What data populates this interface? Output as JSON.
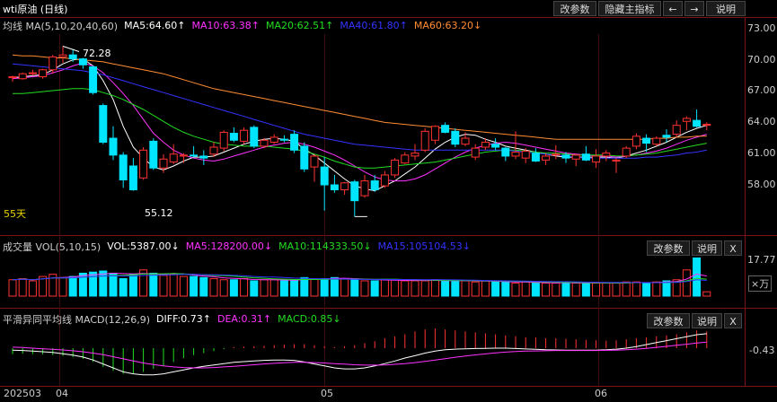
{
  "title": {
    "symbol": "wti原油 (日线)",
    "buttons": [
      "改参数",
      "隐藏主指标",
      "←",
      "→",
      "说明"
    ]
  },
  "main": {
    "ma_label": "均线 MA(5,10,20,40,60)",
    "ma_values": [
      {
        "text": "MA5:64.60↑",
        "color": "#ffffff"
      },
      {
        "text": "MA10:63.38↑",
        "color": "#ff33ff"
      },
      {
        "text": "MA20:62.51↑",
        "color": "#22dd22"
      },
      {
        "text": "MA40:61.80↑",
        "color": "#3333ff"
      },
      {
        "text": "MA60:63.20↓",
        "color": "#ff8c33"
      }
    ],
    "y_ticks": [
      "73.00",
      "70.00",
      "67.00",
      "64.00",
      "61.00",
      "58.00"
    ],
    "high_label": "72.28",
    "low_label": "55.12",
    "period_label": "55天"
  },
  "volume": {
    "label": "成交量 VOL(5,10,15)",
    "values": [
      {
        "text": "VOL:5387.00↓",
        "color": "#ffffff"
      },
      {
        "text": "MA5:128200.00↓",
        "color": "#ff33ff"
      },
      {
        "text": "MA10:114333.50↓",
        "color": "#22dd22"
      },
      {
        "text": "MA15:105104.53↓",
        "color": "#3333ff"
      }
    ],
    "buttons": [
      "改参数",
      "说明",
      "X"
    ],
    "y_tick": "17.77",
    "unit": "×万"
  },
  "macd": {
    "label": "平滑异同平均线 MACD(12,26,9)",
    "values": [
      {
        "text": "DIFF:0.73↑",
        "color": "#ffffff"
      },
      {
        "text": "DEA:0.31↑",
        "color": "#ff33ff"
      },
      {
        "text": "MACD:0.85↓",
        "color": "#22dd22"
      }
    ],
    "buttons": [
      "改参数",
      "说明",
      "X"
    ],
    "y_tick": "-0.43"
  },
  "x_axis": [
    "202503",
    "04",
    "05",
    "06"
  ],
  "colors": {
    "up": "#ff3232",
    "down": "#00e5ff",
    "grid": "#7a1414"
  },
  "chart_data": {
    "type": "candlestick",
    "ylim": [
      54.5,
      73.5
    ],
    "candles": [
      [
        69.1,
        69.3,
        68.7,
        69.2
      ],
      [
        69.0,
        69.6,
        68.9,
        69.5
      ],
      [
        69.5,
        69.9,
        69.3,
        69.6
      ],
      [
        69.2,
        70.0,
        69.0,
        69.9
      ],
      [
        69.9,
        71.4,
        69.5,
        71.2
      ],
      [
        71.2,
        72.28,
        70.6,
        71.4
      ],
      [
        71.4,
        72.0,
        70.7,
        71.0
      ],
      [
        71.0,
        71.1,
        70.0,
        70.4
      ],
      [
        70.2,
        70.3,
        67.4,
        67.6
      ],
      [
        66.3,
        66.5,
        62.4,
        62.6
      ],
      [
        63.0,
        64.2,
        60.8,
        61.3
      ],
      [
        61.3,
        61.6,
        58.0,
        58.8
      ],
      [
        60.2,
        61.0,
        57.7,
        57.8
      ],
      [
        59.0,
        62.1,
        58.8,
        61.8
      ],
      [
        62.7,
        63.0,
        59.8,
        60.0
      ],
      [
        60.0,
        61.4,
        59.5,
        60.9
      ],
      [
        60.6,
        62.4,
        60.4,
        61.4
      ],
      [
        61.2,
        61.5,
        60.5,
        61.3
      ],
      [
        61.3,
        62.2,
        61.1,
        61.2
      ],
      [
        61.2,
        61.8,
        60.3,
        61.0
      ],
      [
        61.4,
        62.6,
        61.1,
        62.1
      ],
      [
        62.0,
        63.8,
        61.7,
        63.6
      ],
      [
        63.5,
        64.1,
        62.6,
        62.8
      ],
      [
        62.7,
        64.1,
        62.4,
        63.8
      ],
      [
        64.1,
        64.3,
        62.0,
        62.2
      ],
      [
        62.2,
        63.0,
        62.0,
        62.8
      ],
      [
        62.6,
        63.4,
        62.4,
        63.1
      ],
      [
        62.9,
        63.3,
        62.6,
        62.8
      ],
      [
        63.4,
        63.8,
        61.5,
        61.8
      ],
      [
        62.2,
        62.6,
        59.6,
        59.9
      ],
      [
        60.1,
        61.4,
        58.6,
        61.2
      ],
      [
        60.1,
        61.1,
        55.7,
        58.3
      ],
      [
        58.3,
        59.3,
        57.5,
        57.8
      ],
      [
        57.8,
        58.6,
        57.3,
        58.5
      ],
      [
        58.6,
        58.8,
        55.1,
        56.7
      ],
      [
        57.2,
        59.3,
        57.0,
        58.7
      ],
      [
        58.7,
        59.3,
        57.6,
        57.8
      ],
      [
        58.2,
        59.7,
        58.0,
        59.3
      ],
      [
        59.3,
        61.0,
        59.0,
        60.8
      ],
      [
        60.5,
        61.6,
        60.4,
        61.3
      ],
      [
        61.2,
        62.4,
        60.8,
        61.5
      ],
      [
        61.8,
        64.0,
        61.6,
        63.7
      ],
      [
        62.8,
        64.3,
        62.4,
        64.2
      ],
      [
        64.3,
        64.6,
        63.5,
        63.6
      ],
      [
        63.7,
        64.0,
        62.1,
        62.4
      ],
      [
        62.4,
        63.6,
        62.2,
        63.0
      ],
      [
        61.1,
        62.4,
        60.8,
        62.0
      ],
      [
        62.1,
        63.0,
        61.8,
        62.6
      ],
      [
        62.4,
        63.0,
        61.8,
        62.1
      ],
      [
        62.0,
        62.1,
        60.7,
        61.2
      ],
      [
        61.2,
        63.7,
        60.9,
        61.6
      ],
      [
        61.0,
        62.0,
        60.5,
        61.7
      ],
      [
        61.5,
        62.0,
        60.6,
        60.7
      ],
      [
        60.8,
        61.5,
        60.3,
        61.2
      ],
      [
        61.3,
        62.3,
        60.9,
        61.4
      ],
      [
        61.3,
        61.6,
        60.5,
        61.0
      ],
      [
        60.9,
        61.4,
        60.2,
        61.3
      ],
      [
        61.4,
        62.2,
        60.7,
        60.8
      ],
      [
        60.6,
        61.9,
        60.0,
        61.2
      ],
      [
        61.2,
        61.8,
        60.7,
        61.5
      ],
      [
        60.7,
        61.0,
        59.5,
        60.8
      ],
      [
        61.2,
        62.2,
        61.0,
        62.0
      ],
      [
        62.2,
        63.5,
        61.9,
        63.2
      ],
      [
        63.0,
        63.4,
        61.6,
        62.5
      ],
      [
        62.4,
        63.2,
        62.2,
        63.0
      ],
      [
        63.3,
        63.9,
        62.6,
        63.1
      ],
      [
        63.4,
        64.8,
        63.1,
        64.3
      ],
      [
        64.7,
        65.2,
        63.8,
        65.0
      ],
      [
        64.8,
        65.9,
        64.1,
        64.2
      ],
      [
        64.3,
        64.6,
        63.8,
        64.4
      ]
    ],
    "ma_lines": {
      "MA5": [
        69.1,
        69.2,
        69.3,
        69.4,
        69.9,
        70.5,
        70.9,
        71.0,
        70.3,
        68.8,
        66.9,
        64.2,
        62.1,
        61.0,
        60.1,
        59.8,
        60.2,
        60.7,
        61.1,
        61.1,
        61.2,
        61.6,
        62.0,
        62.4,
        62.7,
        62.9,
        63.0,
        62.9,
        62.7,
        61.9,
        61.3,
        60.5,
        59.7,
        58.9,
        58.2,
        57.9,
        57.7,
        58.2,
        58.7,
        59.4,
        60.1,
        61.0,
        61.9,
        62.6,
        63.1,
        63.4,
        63.3,
        62.9,
        62.6,
        62.2,
        62.0,
        61.8,
        61.6,
        61.4,
        61.2,
        61.1,
        61.1,
        61.1,
        61.1,
        61.1,
        61.0,
        61.2,
        61.5,
        61.8,
        62.2,
        62.6,
        63.1,
        63.6,
        64.0,
        64.3
      ],
      "MA10": [
        69.0,
        69.1,
        69.2,
        69.3,
        69.6,
        69.9,
        70.3,
        70.6,
        70.3,
        69.6,
        68.6,
        67.5,
        66.3,
        64.9,
        63.5,
        62.6,
        61.8,
        61.3,
        61.0,
        60.8,
        60.7,
        60.9,
        61.2,
        61.5,
        61.8,
        62.1,
        62.3,
        62.5,
        62.6,
        62.4,
        62.1,
        61.7,
        61.3,
        60.8,
        60.2,
        59.6,
        59.1,
        58.8,
        58.7,
        58.7,
        58.9,
        59.3,
        59.9,
        60.5,
        61.1,
        61.6,
        62.0,
        62.3,
        62.5,
        62.6,
        62.5,
        62.3,
        62.1,
        61.9,
        61.7,
        61.5,
        61.4,
        61.3,
        61.2,
        61.2,
        61.1,
        61.2,
        61.3,
        61.5,
        61.7,
        62.0,
        62.4,
        62.8,
        63.1,
        63.4
      ],
      "MA20": [
        67.5,
        67.5,
        67.6,
        67.7,
        67.8,
        67.9,
        68.0,
        68.0,
        67.9,
        67.6,
        67.3,
        66.9,
        66.4,
        65.9,
        65.3,
        64.7,
        64.1,
        63.6,
        63.2,
        62.9,
        62.6,
        62.4,
        62.3,
        62.2,
        62.2,
        62.2,
        62.1,
        62.0,
        61.9,
        61.7,
        61.4,
        61.1,
        60.7,
        60.4,
        60.1,
        60.0,
        60.0,
        60.1,
        60.2,
        60.3,
        60.4,
        60.5,
        60.6,
        60.8,
        61.0,
        61.2,
        61.4,
        61.6,
        61.7,
        61.8,
        61.8,
        61.7,
        61.6,
        61.5,
        61.5,
        61.4,
        61.3,
        61.3,
        61.3,
        61.3,
        61.2,
        61.2,
        61.3,
        61.4,
        61.5,
        61.7,
        61.9,
        62.1,
        62.3,
        62.5
      ],
      "MA40": [
        70.5,
        70.4,
        70.3,
        70.2,
        70.1,
        70.0,
        69.9,
        69.8,
        69.6,
        69.4,
        69.1,
        68.8,
        68.5,
        68.2,
        67.9,
        67.6,
        67.3,
        67.0,
        66.7,
        66.4,
        66.1,
        65.8,
        65.5,
        65.2,
        64.9,
        64.6,
        64.3,
        64.0,
        63.7,
        63.4,
        63.2,
        63.0,
        62.8,
        62.6,
        62.4,
        62.3,
        62.2,
        62.1,
        62.0,
        61.9,
        61.8,
        61.8,
        61.8,
        61.8,
        61.8,
        61.8,
        61.8,
        61.8,
        61.8,
        61.8,
        61.7,
        61.6,
        61.5,
        61.4,
        61.3,
        61.2,
        61.1,
        61.0,
        61.0,
        61.0,
        61.0,
        61.0,
        61.0,
        61.1,
        61.1,
        61.2,
        61.3,
        61.5,
        61.6,
        61.8
      ],
      "MA60": [
        71.4,
        71.3,
        71.3,
        71.2,
        71.1,
        71.1,
        71.0,
        70.9,
        70.8,
        70.7,
        70.5,
        70.3,
        70.1,
        69.9,
        69.7,
        69.5,
        69.2,
        68.9,
        68.6,
        68.3,
        68.0,
        67.8,
        67.6,
        67.4,
        67.2,
        67.0,
        66.8,
        66.6,
        66.4,
        66.2,
        66.0,
        65.8,
        65.6,
        65.4,
        65.2,
        65.0,
        64.8,
        64.6,
        64.5,
        64.4,
        64.3,
        64.2,
        64.1,
        64.0,
        63.9,
        63.8,
        63.7,
        63.6,
        63.5,
        63.4,
        63.3,
        63.2,
        63.1,
        63.0,
        62.9,
        62.9,
        62.9,
        62.9,
        62.9,
        62.9,
        62.9,
        62.9,
        62.9,
        62.9,
        63.0,
        63.0,
        63.1,
        63.1,
        63.2,
        63.2
      ]
    },
    "volume": [
      7.5,
      8.0,
      7.0,
      9.0,
      10.0,
      8.5,
      9.0,
      10.5,
      11.0,
      11.5,
      10.5,
      8.0,
      10.0,
      12.0,
      10.5,
      9.5,
      10.0,
      9.0,
      9.0,
      8.5,
      8.0,
      7.5,
      7.5,
      8.0,
      7.0,
      7.5,
      7.5,
      7.0,
      7.5,
      8.5,
      8.0,
      8.0,
      8.5,
      8.0,
      7.5,
      7.0,
      7.0,
      7.5,
      7.5,
      7.0,
      7.0,
      7.0,
      7.5,
      7.0,
      7.0,
      7.0,
      6.5,
      7.0,
      6.5,
      6.5,
      6.0,
      6.5,
      6.0,
      6.0,
      6.0,
      6.5,
      6.0,
      6.0,
      6.0,
      6.0,
      6.0,
      6.5,
      6.5,
      6.0,
      6.5,
      7.0,
      7.5,
      12.0,
      17.5,
      2.0
    ],
    "vol_ylim": [
      0,
      18.5
    ],
    "macd_hist": [
      -0.3,
      -0.28,
      -0.3,
      -0.32,
      -0.35,
      -0.4,
      -0.45,
      -0.55,
      -0.7,
      -0.95,
      -1.15,
      -1.3,
      -1.28,
      -1.2,
      -1.05,
      -0.9,
      -0.7,
      -0.5,
      -0.35,
      -0.25,
      -0.15,
      -0.05,
      0.05,
      0.08,
      0.1,
      0.12,
      0.15,
      0.18,
      0.2,
      0.2,
      0.15,
      0.1,
      0.05,
      0.1,
      0.15,
      0.25,
      0.35,
      0.5,
      0.6,
      0.7,
      0.85,
      0.95,
      1.0,
      0.95,
      0.9,
      0.85,
      0.8,
      0.75,
      0.7,
      0.65,
      0.6,
      0.55,
      0.55,
      0.5,
      0.5,
      0.48,
      0.45,
      0.42,
      0.4,
      0.38,
      0.4,
      0.45,
      0.5,
      0.55,
      0.6,
      0.65,
      0.7,
      0.8,
      0.9,
      0.85
    ],
    "diff": [
      -0.1,
      -0.12,
      -0.15,
      -0.18,
      -0.22,
      -0.28,
      -0.35,
      -0.45,
      -0.6,
      -0.8,
      -1.0,
      -1.2,
      -1.3,
      -1.35,
      -1.35,
      -1.3,
      -1.2,
      -1.1,
      -1.0,
      -0.92,
      -0.85,
      -0.78,
      -0.72,
      -0.68,
      -0.65,
      -0.62,
      -0.6,
      -0.6,
      -0.62,
      -0.7,
      -0.8,
      -0.9,
      -1.0,
      -1.05,
      -1.05,
      -1.0,
      -0.9,
      -0.78,
      -0.65,
      -0.5,
      -0.38,
      -0.25,
      -0.15,
      -0.08,
      -0.05,
      -0.03,
      -0.02,
      -0.01,
      0.0,
      0.0,
      -0.02,
      -0.04,
      -0.06,
      -0.08,
      -0.09,
      -0.1,
      -0.1,
      -0.1,
      -0.1,
      -0.08,
      -0.05,
      0.0,
      0.08,
      0.18,
      0.28,
      0.38,
      0.48,
      0.58,
      0.68,
      0.73
    ],
    "dea": [
      0.05,
      0.03,
      0.0,
      -0.03,
      -0.06,
      -0.09,
      -0.13,
      -0.18,
      -0.25,
      -0.33,
      -0.43,
      -0.54,
      -0.65,
      -0.75,
      -0.83,
      -0.9,
      -0.95,
      -0.98,
      -1.0,
      -1.0,
      -0.98,
      -0.95,
      -0.92,
      -0.88,
      -0.84,
      -0.8,
      -0.77,
      -0.74,
      -0.72,
      -0.72,
      -0.73,
      -0.75,
      -0.78,
      -0.81,
      -0.84,
      -0.86,
      -0.86,
      -0.85,
      -0.82,
      -0.78,
      -0.73,
      -0.67,
      -0.6,
      -0.53,
      -0.46,
      -0.4,
      -0.34,
      -0.29,
      -0.24,
      -0.2,
      -0.17,
      -0.15,
      -0.14,
      -0.13,
      -0.12,
      -0.12,
      -0.12,
      -0.12,
      -0.12,
      -0.11,
      -0.1,
      -0.08,
      -0.05,
      -0.01,
      0.04,
      0.09,
      0.15,
      0.2,
      0.26,
      0.31
    ]
  }
}
